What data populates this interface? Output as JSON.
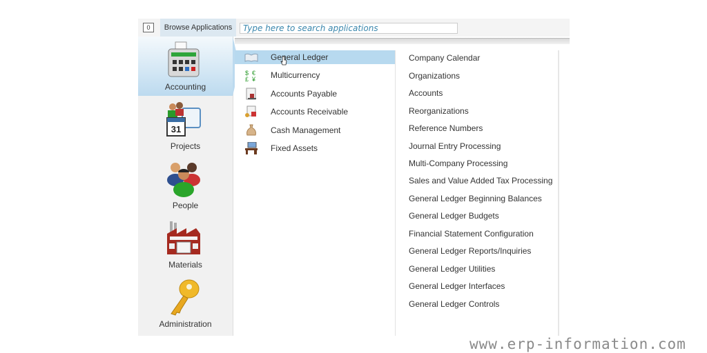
{
  "topbar": {
    "counter": "0",
    "browse_label": "Browse Applications",
    "search_placeholder": "Type here to search applications"
  },
  "sidebar": {
    "items": [
      {
        "label": "Accounting",
        "icon": "calculator-icon",
        "active": true
      },
      {
        "label": "Projects",
        "icon": "calendar-people-icon",
        "active": false
      },
      {
        "label": "People",
        "icon": "people-icon",
        "active": false
      },
      {
        "label": "Materials",
        "icon": "factory-icon",
        "active": false
      },
      {
        "label": "Administration",
        "icon": "key-icon",
        "active": false
      }
    ]
  },
  "modules": {
    "items": [
      {
        "label": "General Ledger",
        "icon": "ledger-book-icon",
        "selected": true
      },
      {
        "label": "Multicurrency",
        "icon": "currency-icon",
        "selected": false
      },
      {
        "label": "Accounts Payable",
        "icon": "stamp-document-icon",
        "selected": false
      },
      {
        "label": "Accounts Receivable",
        "icon": "receivable-icon",
        "selected": false
      },
      {
        "label": "Cash Management",
        "icon": "money-bag-icon",
        "selected": false
      },
      {
        "label": "Fixed Assets",
        "icon": "desk-icon",
        "selected": false
      }
    ]
  },
  "functions": {
    "items": [
      "Company Calendar",
      "Organizations",
      "Accounts",
      "Reorganizations",
      "Reference Numbers",
      "Journal Entry Processing",
      "Multi-Company Processing",
      "Sales and Value Added Tax Processing",
      "General Ledger Beginning Balances",
      "General Ledger Budgets",
      "Financial Statement Configuration",
      "General Ledger Reports/Inquiries",
      "General Ledger Utilities",
      "General Ledger Interfaces",
      "General Ledger Controls"
    ]
  },
  "watermark": "www.erp-information.com",
  "colors": {
    "selected_bg": "#b7d9ef",
    "browse_tab_bg": "#dce8f1",
    "search_text": "#3a87ad"
  }
}
